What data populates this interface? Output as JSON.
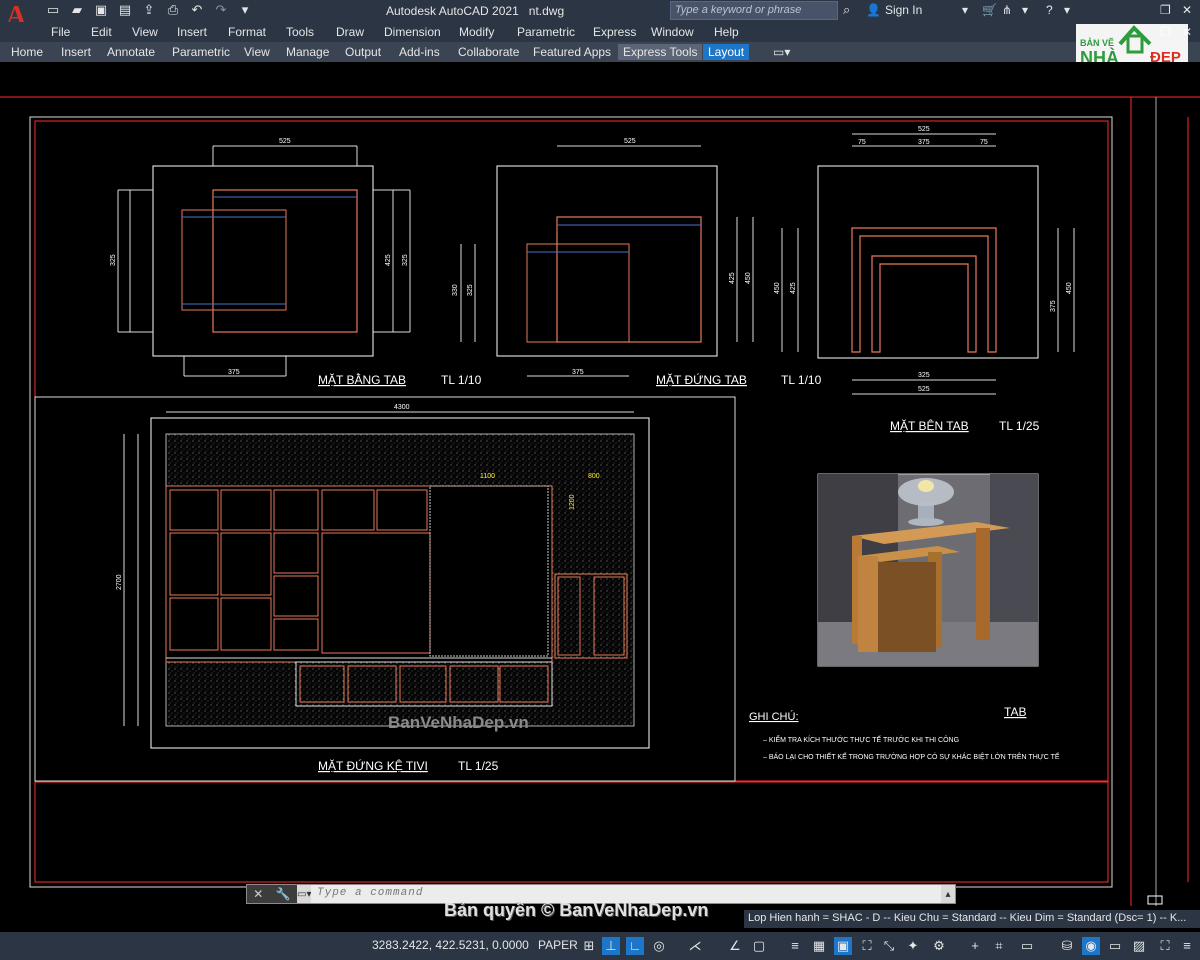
{
  "app": {
    "title": "Autodesk AutoCAD 2021",
    "file": "nt.dwg",
    "search_placeholder": "Type a keyword or phrase",
    "signin": "Sign In"
  },
  "menu": [
    "File",
    "Edit",
    "View",
    "Insert",
    "Format",
    "Tools",
    "Draw",
    "Dimension",
    "Modify",
    "Parametric",
    "Express",
    "Window",
    "Help"
  ],
  "ribbon_tabs": [
    "Home",
    "Insert",
    "Annotate",
    "Parametric",
    "View",
    "Manage",
    "Output",
    "Add-ins",
    "Collaborate",
    "Featured Apps",
    "Express Tools",
    "Layout"
  ],
  "watermark": {
    "line1": "BẢN VẼ",
    "line2": "NHÀ",
    "line3": "ĐẸP"
  },
  "drawing": {
    "plan_title": "MẶT BẰNG TAB",
    "plan_scale": "TL 1/10",
    "elev_title": "MẶT ĐỨNG TAB",
    "elev_scale": "TL 1/10",
    "side_title": "MẶT BÊN TAB",
    "side_scale": "TL 1/25",
    "tv_title": "MẶT ĐỨNG KỆ TIVI",
    "tv_scale": "TL 1/25",
    "photo_label": "TAB",
    "notes_title": "GHI CHÚ:",
    "note1": "–  KIỂM TRA KÍCH THƯỚC THỰC TẾ TRƯỚC KHI THI CÔNG",
    "note2": "–  BÁO LẠI CHO THIẾT KẾ TRONG TRƯỜNG HỢP CÓ SỰ KHÁC BIỆT LỚN TRÊN THỰC TẾ",
    "watermark_text": "BanVeNhaDep.vn",
    "dims": {
      "plan_top": "525",
      "plan_bottom": "375",
      "plan_left": "325",
      "plan_right_a": "425",
      "plan_right_b": "325",
      "elev_top": "525",
      "elev_bottom": "375",
      "elev_left_a": "330",
      "elev_left_b": "325",
      "elev_right_a": "425",
      "elev_right_b": "450",
      "side_top": "525",
      "side_top_a": "75",
      "side_top_b": "375",
      "side_top_c": "75",
      "side_bottom_a": "325",
      "side_bottom_b": "525",
      "side_left_a": "450",
      "side_left_b": "425",
      "side_right_a": "375",
      "side_right_b": "450",
      "tv_width": "4300",
      "tv_height": "2700",
      "tv_1100": "1100",
      "tv_800": "800",
      "tv_1200": "1200"
    }
  },
  "command": {
    "placeholder": "Type a command"
  },
  "status": {
    "layer_line": "Lop Hien hanh = SHAC - D -- Kieu Chu = Standard -- Kieu Dim = Standard (Dsc= 1) -- K...",
    "copyright": "Bản quyền © BanVeNhaDep.vn",
    "coords": "3283.2422, 422.5231, 0.0000",
    "space": "PAPER"
  },
  "colors": {
    "frame": "#ff2a2a",
    "cabinet": "#e8795b",
    "blue": "#4a72c8",
    "ui_bg": "#2b3544",
    "accent": "#1e76c9"
  }
}
